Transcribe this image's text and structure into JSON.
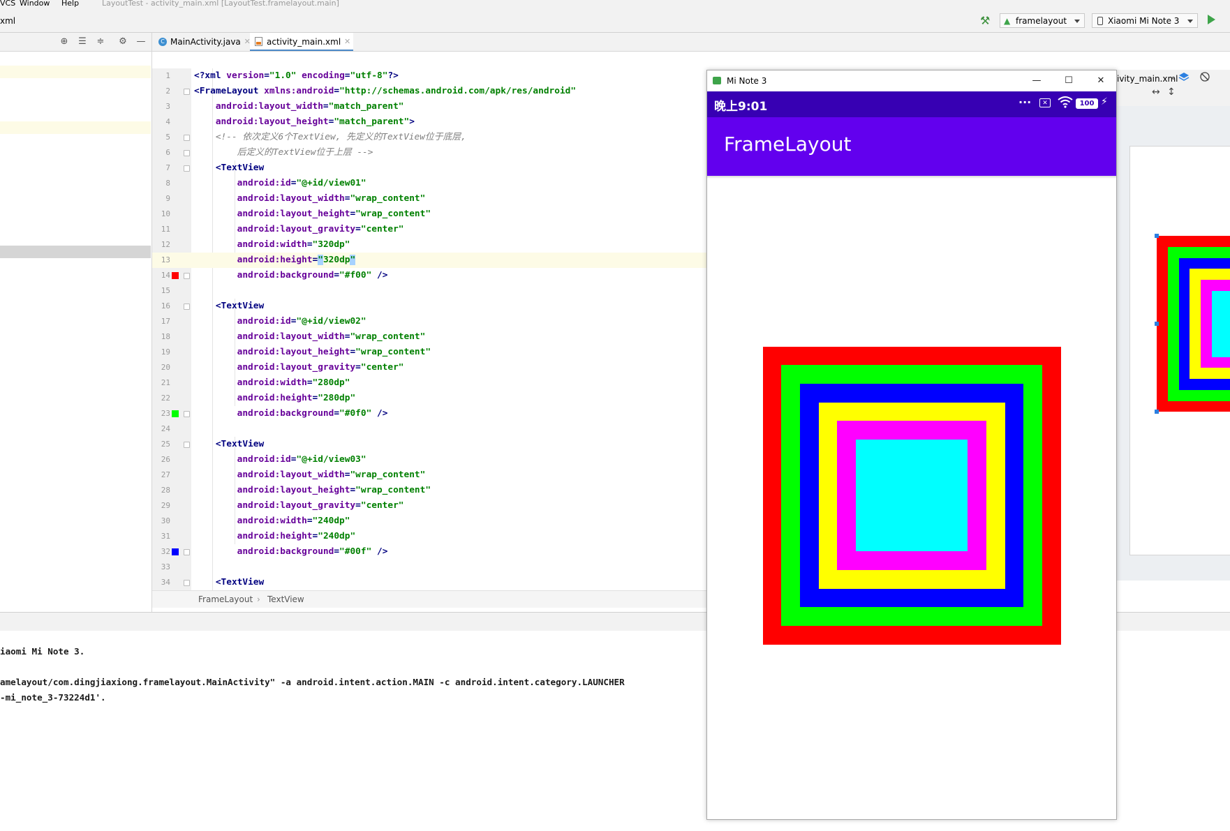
{
  "menubar": {
    "items": [
      "VCS",
      "Window",
      "Help"
    ],
    "title": "LayoutTest - activity_main.xml [LayoutTest.framelayout.main]"
  },
  "toolbar": {
    "breadcrumb": "xml",
    "run_config": "framelayout",
    "device": "Xiaomi Mi Note 3"
  },
  "tabs": [
    {
      "label": "MainActivity.java",
      "active": false
    },
    {
      "label": "activity_main.xml",
      "active": true
    }
  ],
  "editor": {
    "lines": [
      {
        "n": "1",
        "code": [
          [
            "punc",
            "<?"
          ],
          [
            "tag",
            "xml "
          ],
          [
            "attr",
            "version"
          ],
          [
            "punc",
            "="
          ],
          [
            "val",
            "\"1.0\""
          ],
          [
            "attr",
            " encoding"
          ],
          [
            "punc",
            "="
          ],
          [
            "val",
            "\"utf-8\""
          ],
          [
            "punc",
            "?>"
          ]
        ]
      },
      {
        "n": "2",
        "code": [
          [
            "punc",
            "<"
          ],
          [
            "tag",
            "FrameLayout "
          ],
          [
            "attr",
            "xmlns:android"
          ],
          [
            "punc",
            "="
          ],
          [
            "val",
            "\"http://schemas.android.com/apk/res/android\""
          ]
        ]
      },
      {
        "n": "3",
        "code": [
          [
            "plain",
            "    "
          ],
          [
            "attr",
            "android:layout_width"
          ],
          [
            "punc",
            "="
          ],
          [
            "val",
            "\"match_parent\""
          ]
        ]
      },
      {
        "n": "4",
        "code": [
          [
            "plain",
            "    "
          ],
          [
            "attr",
            "android:layout_height"
          ],
          [
            "punc",
            "="
          ],
          [
            "val",
            "\"match_parent\""
          ],
          [
            "punc",
            ">"
          ]
        ]
      },
      {
        "n": "5",
        "code": [
          [
            "plain",
            "    "
          ],
          [
            "cmt",
            "<!-- 依次定义6个TextView, 先定义的TextView位于底层,"
          ]
        ]
      },
      {
        "n": "6",
        "code": [
          [
            "plain",
            "        "
          ],
          [
            "cmt",
            "后定义的TextView位于上层 -->"
          ]
        ]
      },
      {
        "n": "7",
        "code": [
          [
            "plain",
            "    "
          ],
          [
            "punc",
            "<"
          ],
          [
            "tag",
            "TextView"
          ]
        ]
      },
      {
        "n": "8",
        "code": [
          [
            "plain",
            "        "
          ],
          [
            "attr",
            "android:id"
          ],
          [
            "punc",
            "="
          ],
          [
            "val",
            "\"@+id/view01\""
          ]
        ]
      },
      {
        "n": "9",
        "code": [
          [
            "plain",
            "        "
          ],
          [
            "attr",
            "android:layout_width"
          ],
          [
            "punc",
            "="
          ],
          [
            "val",
            "\"wrap_content\""
          ]
        ]
      },
      {
        "n": "10",
        "code": [
          [
            "plain",
            "        "
          ],
          [
            "attr",
            "android:layout_height"
          ],
          [
            "punc",
            "="
          ],
          [
            "val",
            "\"wrap_content\""
          ]
        ]
      },
      {
        "n": "11",
        "code": [
          [
            "plain",
            "        "
          ],
          [
            "attr",
            "android:layout_gravity"
          ],
          [
            "punc",
            "="
          ],
          [
            "val",
            "\"center\""
          ]
        ]
      },
      {
        "n": "12",
        "code": [
          [
            "plain",
            "        "
          ],
          [
            "attr",
            "android:width"
          ],
          [
            "punc",
            "="
          ],
          [
            "val",
            "\"320dp\""
          ]
        ]
      },
      {
        "n": "13",
        "code": [
          [
            "plain",
            "        "
          ],
          [
            "attr",
            "android:height"
          ],
          [
            "punc",
            "="
          ],
          [
            "sel",
            "\""
          ],
          [
            "val",
            "320dp"
          ],
          [
            "sel",
            "\""
          ]
        ]
      },
      {
        "n": "14",
        "code": [
          [
            "plain",
            "        "
          ],
          [
            "attr",
            "android:background"
          ],
          [
            "punc",
            "="
          ],
          [
            "val",
            "\"#f00\""
          ],
          [
            "punc",
            " />"
          ]
        ]
      },
      {
        "n": "15",
        "code": []
      },
      {
        "n": "16",
        "code": [
          [
            "plain",
            "    "
          ],
          [
            "punc",
            "<"
          ],
          [
            "tag",
            "TextView"
          ]
        ]
      },
      {
        "n": "17",
        "code": [
          [
            "plain",
            "        "
          ],
          [
            "attr",
            "android:id"
          ],
          [
            "punc",
            "="
          ],
          [
            "val",
            "\"@+id/view02\""
          ]
        ]
      },
      {
        "n": "18",
        "code": [
          [
            "plain",
            "        "
          ],
          [
            "attr",
            "android:layout_width"
          ],
          [
            "punc",
            "="
          ],
          [
            "val",
            "\"wrap_content\""
          ]
        ]
      },
      {
        "n": "19",
        "code": [
          [
            "plain",
            "        "
          ],
          [
            "attr",
            "android:layout_height"
          ],
          [
            "punc",
            "="
          ],
          [
            "val",
            "\"wrap_content\""
          ]
        ]
      },
      {
        "n": "20",
        "code": [
          [
            "plain",
            "        "
          ],
          [
            "attr",
            "android:layout_gravity"
          ],
          [
            "punc",
            "="
          ],
          [
            "val",
            "\"center\""
          ]
        ]
      },
      {
        "n": "21",
        "code": [
          [
            "plain",
            "        "
          ],
          [
            "attr",
            "android:width"
          ],
          [
            "punc",
            "="
          ],
          [
            "val",
            "\"280dp\""
          ]
        ]
      },
      {
        "n": "22",
        "code": [
          [
            "plain",
            "        "
          ],
          [
            "attr",
            "android:height"
          ],
          [
            "punc",
            "="
          ],
          [
            "val",
            "\"280dp\""
          ]
        ]
      },
      {
        "n": "23",
        "code": [
          [
            "plain",
            "        "
          ],
          [
            "attr",
            "android:background"
          ],
          [
            "punc",
            "="
          ],
          [
            "val",
            "\"#0f0\""
          ],
          [
            "punc",
            " />"
          ]
        ]
      },
      {
        "n": "24",
        "code": []
      },
      {
        "n": "25",
        "code": [
          [
            "plain",
            "    "
          ],
          [
            "punc",
            "<"
          ],
          [
            "tag",
            "TextView"
          ]
        ]
      },
      {
        "n": "26",
        "code": [
          [
            "plain",
            "        "
          ],
          [
            "attr",
            "android:id"
          ],
          [
            "punc",
            "="
          ],
          [
            "val",
            "\"@+id/view03\""
          ]
        ]
      },
      {
        "n": "27",
        "code": [
          [
            "plain",
            "        "
          ],
          [
            "attr",
            "android:layout_width"
          ],
          [
            "punc",
            "="
          ],
          [
            "val",
            "\"wrap_content\""
          ]
        ]
      },
      {
        "n": "28",
        "code": [
          [
            "plain",
            "        "
          ],
          [
            "attr",
            "android:layout_height"
          ],
          [
            "punc",
            "="
          ],
          [
            "val",
            "\"wrap_content\""
          ]
        ]
      },
      {
        "n": "29",
        "code": [
          [
            "plain",
            "        "
          ],
          [
            "attr",
            "android:layout_gravity"
          ],
          [
            "punc",
            "="
          ],
          [
            "val",
            "\"center\""
          ]
        ]
      },
      {
        "n": "30",
        "code": [
          [
            "plain",
            "        "
          ],
          [
            "attr",
            "android:width"
          ],
          [
            "punc",
            "="
          ],
          [
            "val",
            "\"240dp\""
          ]
        ]
      },
      {
        "n": "31",
        "code": [
          [
            "plain",
            "        "
          ],
          [
            "attr",
            "android:height"
          ],
          [
            "punc",
            "="
          ],
          [
            "val",
            "\"240dp\""
          ]
        ]
      },
      {
        "n": "32",
        "code": [
          [
            "plain",
            "        "
          ],
          [
            "attr",
            "android:background"
          ],
          [
            "punc",
            "="
          ],
          [
            "val",
            "\"#00f\""
          ],
          [
            "punc",
            " />"
          ]
        ]
      },
      {
        "n": "33",
        "code": []
      },
      {
        "n": "34",
        "code": [
          [
            "plain",
            "    "
          ],
          [
            "punc",
            "<"
          ],
          [
            "tag",
            "TextView"
          ]
        ]
      }
    ],
    "swatches": {
      "14": "#ff0000",
      "23": "#00ff00",
      "32": "#0000ff"
    },
    "highlight_lines": [
      "13"
    ]
  },
  "breadcrumb": [
    "FrameLayout",
    "TextView"
  ],
  "console": {
    "lines": [
      "iaomi Mi Note 3.",
      "",
      "amelayout/com.dingjiaxiong.framelayout.MainActivity\" -a android.intent.action.MAIN -c android.intent.category.LAUNCHER",
      "-mi_note_3-73224d1'."
    ]
  },
  "design": {
    "file_label": "ivity_main.xml"
  },
  "emulator": {
    "window_title": "Mi Note 3",
    "time": "晚上9:01",
    "battery": "100",
    "app_title": "FrameLayout",
    "views": [
      {
        "id": "view01",
        "size_dp": 320,
        "color": "#ff0000"
      },
      {
        "id": "view02",
        "size_dp": 280,
        "color": "#00ff00"
      },
      {
        "id": "view03",
        "size_dp": 240,
        "color": "#0000ff"
      },
      {
        "id": "view04",
        "size_dp": 200,
        "color": "#ffff00"
      },
      {
        "id": "view05",
        "size_dp": 160,
        "color": "#ff00ff"
      },
      {
        "id": "view06",
        "size_dp": 120,
        "color": "#00ffff"
      }
    ]
  }
}
